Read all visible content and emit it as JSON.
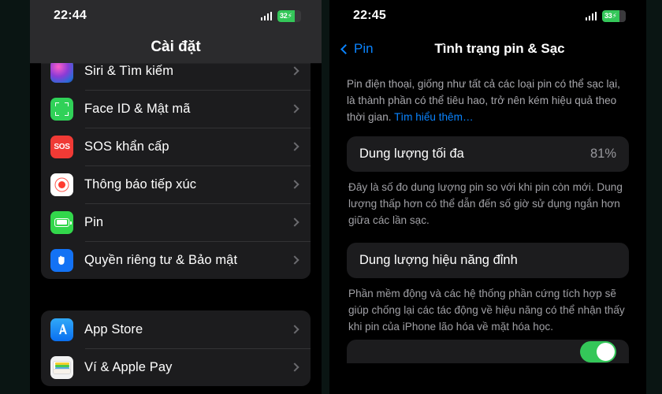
{
  "left_phone": {
    "status_bar": {
      "time": "22:44",
      "battery_level": "32",
      "charging": true,
      "signal_icon": "cellular-signal-icon",
      "battery_icon": "battery-charging-icon"
    },
    "nav": {
      "title": "Cài đặt"
    },
    "groups": [
      {
        "rows": [
          {
            "label": "Siri & Tìm kiếm",
            "icon": "siri-icon",
            "icon_class": "ic-siri",
            "art": "siri",
            "clipped": true
          },
          {
            "label": "Face ID & Mật mã",
            "icon": "face-id-icon",
            "icon_class": "ic-faceid",
            "art": "faceid"
          },
          {
            "label": "SOS khẩn cấp",
            "icon": "sos-icon",
            "icon_class": "ic-sos",
            "art": "sos",
            "glyph": "SOS"
          },
          {
            "label": "Thông báo tiếp xúc",
            "icon": "exposure-notification-icon",
            "icon_class": "ic-expo",
            "art": "expo"
          },
          {
            "label": "Pin",
            "icon": "battery-icon",
            "icon_class": "ic-pin",
            "art": "battery"
          },
          {
            "label": "Quyền riêng tư & Bảo mật",
            "icon": "privacy-hand-icon",
            "icon_class": "ic-priv",
            "art": "hand",
            "glyph": "✋"
          }
        ]
      },
      {
        "rows": [
          {
            "label": "App Store",
            "icon": "app-store-icon",
            "icon_class": "ic-appstore",
            "art": "appstore",
            "glyph": "A"
          },
          {
            "label": "Ví & Apple Pay",
            "icon": "wallet-icon",
            "icon_class": "ic-wallet",
            "art": "wallet"
          }
        ]
      }
    ],
    "chevron_icon": "chevron-right-icon"
  },
  "right_phone": {
    "status_bar": {
      "time": "22:45",
      "battery_level": "33",
      "charging": true,
      "signal_icon": "cellular-signal-icon",
      "battery_icon": "battery-charging-icon"
    },
    "nav": {
      "back_label": "Pin",
      "back_icon": "chevron-left-icon",
      "title": "Tình trạng pin & Sạc"
    },
    "intro": {
      "text": "Pin điện thoại, giống như tất cả các loại pin có thể sạc lại, là thành phần có thể tiêu hao, trở nên kém hiệu quả theo thời gian. ",
      "link": "Tìm hiểu thêm…"
    },
    "max_capacity": {
      "label": "Dung lượng tối đa",
      "value": "81%"
    },
    "max_capacity_note": "Đây là số đo dung lượng pin so với khi pin còn mới. Dung lượng thấp hơn có thể dẫn đến số giờ sử dụng ngắn hơn giữa các lần sạc.",
    "peak_performance": {
      "label": "Dung lượng hiệu năng đỉnh"
    },
    "peak_performance_note": "Phần mềm động và các hệ thống phần cứng tích hợp sẽ giúp chống lại các tác động về hiệu năng có thể nhận thấy khi pin của iPhone lão hóa về mặt hóa học.",
    "partial_row": {
      "toggle_icon": "toggle-switch-on",
      "toggle_on": true
    }
  },
  "colors": {
    "page_background": "#0a1513",
    "phone_background": "#000000",
    "card_background": "#1c1c1e",
    "accent_blue": "#0a84ff",
    "accent_green": "#34c759",
    "text_primary": "#ffffff",
    "text_secondary": "#a8a8ad"
  }
}
